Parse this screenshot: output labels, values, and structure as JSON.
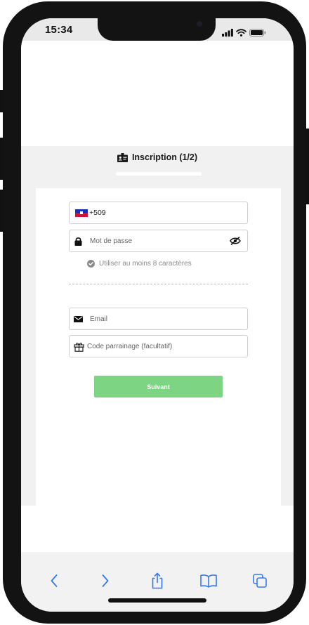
{
  "status_bar": {
    "time": "15:34"
  },
  "header": {
    "title": "Inscription (1/2)",
    "progress": 0.5
  },
  "form": {
    "phone_value": "+509",
    "password_placeholder": "Mot de passe",
    "password_hint": "Utiliser au moins 8 caractères",
    "email_placeholder": "Email",
    "referral_placeholder": "Code parrainage (facultatif)",
    "next_label": "Suivant"
  },
  "icons": {
    "title": "id-card-icon",
    "flag": "haiti-flag-icon",
    "password": "lock-icon",
    "visibility": "eye-off-icon",
    "hint": "check-circle-icon",
    "email": "envelope-icon",
    "referral": "gift-icon",
    "toolbar": [
      "back-icon",
      "forward-icon",
      "share-icon",
      "bookmarks-icon",
      "tabs-icon"
    ]
  },
  "colors": {
    "accent_green": "#7dd482",
    "browser_blue": "#3478f6",
    "haiti_blue": "#1a2fb8",
    "haiti_red": "#d21034",
    "background_grey": "#f1f1f1"
  }
}
